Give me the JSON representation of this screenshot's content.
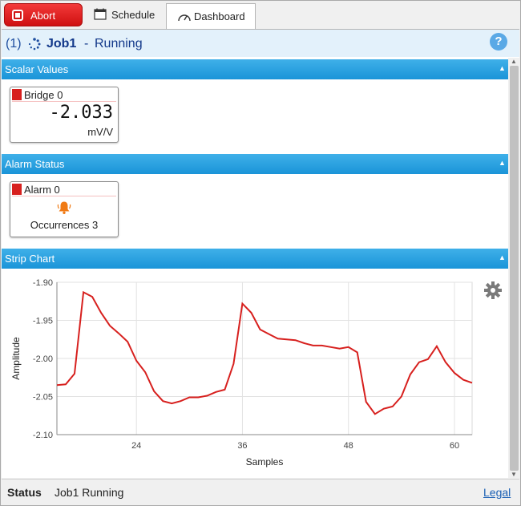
{
  "toolbar": {
    "abort_label": "Abort"
  },
  "tabs": [
    {
      "label": "Schedule",
      "icon": "calendar-icon"
    },
    {
      "label": "Dashboard",
      "icon": "gauge-icon",
      "active": true
    }
  ],
  "job": {
    "count": "(1)",
    "name": "Job1",
    "separator": "-",
    "state": "Running",
    "help": "?"
  },
  "sections": {
    "scalar": {
      "title": "Scalar Values"
    },
    "alarm": {
      "title": "Alarm Status"
    },
    "strip": {
      "title": "Strip Chart"
    }
  },
  "scalar_card": {
    "name": "Bridge 0",
    "value": "-2.033",
    "unit": "mV/V"
  },
  "alarm_card": {
    "name": "Alarm 0",
    "occurrences": "Occurrences 3"
  },
  "status": {
    "key": "Status",
    "value": "Job1 Running",
    "legal": "Legal"
  },
  "colors": {
    "accent": "#1a94d8",
    "series": "#d7201e",
    "abort": "#d01414"
  },
  "chart_data": {
    "type": "line",
    "xlabel": "Samples",
    "ylabel": "Amplitude",
    "xlim": [
      15,
      62
    ],
    "ylim": [
      -2.1,
      -1.9
    ],
    "x_ticks": [
      24,
      36,
      48,
      60
    ],
    "y_ticks": [
      "-1.90",
      "-1.95",
      "-2.00",
      "-2.05",
      "-2.10"
    ],
    "y_tick_values": [
      -1.9,
      -1.95,
      -2.0,
      -2.05,
      -2.1
    ],
    "grid": true,
    "series": [
      {
        "x": [
          15,
          16,
          17,
          18,
          19,
          20,
          21,
          22,
          23,
          24,
          25,
          26,
          27,
          28,
          29,
          30,
          31,
          32,
          33,
          34,
          35,
          36,
          37,
          38,
          39,
          40,
          41,
          42,
          43,
          44,
          45,
          46,
          47,
          48,
          49,
          50,
          51,
          52,
          53,
          54,
          55,
          56,
          57,
          58,
          59,
          60,
          61,
          62
        ],
        "y": [
          -2.035,
          -2.034,
          -2.02,
          -1.913,
          -1.919,
          -1.94,
          -1.957,
          -1.967,
          -1.978,
          -2.003,
          -2.018,
          -2.043,
          -2.056,
          -2.059,
          -2.056,
          -2.051,
          -2.051,
          -2.049,
          -2.044,
          -2.041,
          -2.007,
          -1.928,
          -1.94,
          -1.962,
          -1.968,
          -1.974,
          -1.975,
          -1.976,
          -1.98,
          -1.983,
          -1.983,
          -1.985,
          -1.987,
          -1.985,
          -1.992,
          -2.057,
          -2.073,
          -2.066,
          -2.063,
          -2.05,
          -2.021,
          -2.005,
          -2.001,
          -1.984,
          -2.005,
          -2.019,
          -2.028,
          -2.032
        ]
      }
    ]
  }
}
